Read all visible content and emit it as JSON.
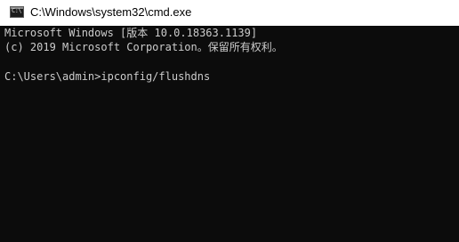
{
  "window": {
    "title": "C:\\Windows\\system32\\cmd.exe",
    "icon": "cmd-icon",
    "icon_glyph": "C:\\"
  },
  "console": {
    "lines": [
      "Microsoft Windows [版本 10.0.18363.1139]",
      "(c) 2019 Microsoft Corporation。保留所有权利。"
    ],
    "prompt": "C:\\Users\\admin>",
    "command": "ipconfig/flushdns",
    "background": "#0c0c0c",
    "foreground": "#cccccc"
  }
}
